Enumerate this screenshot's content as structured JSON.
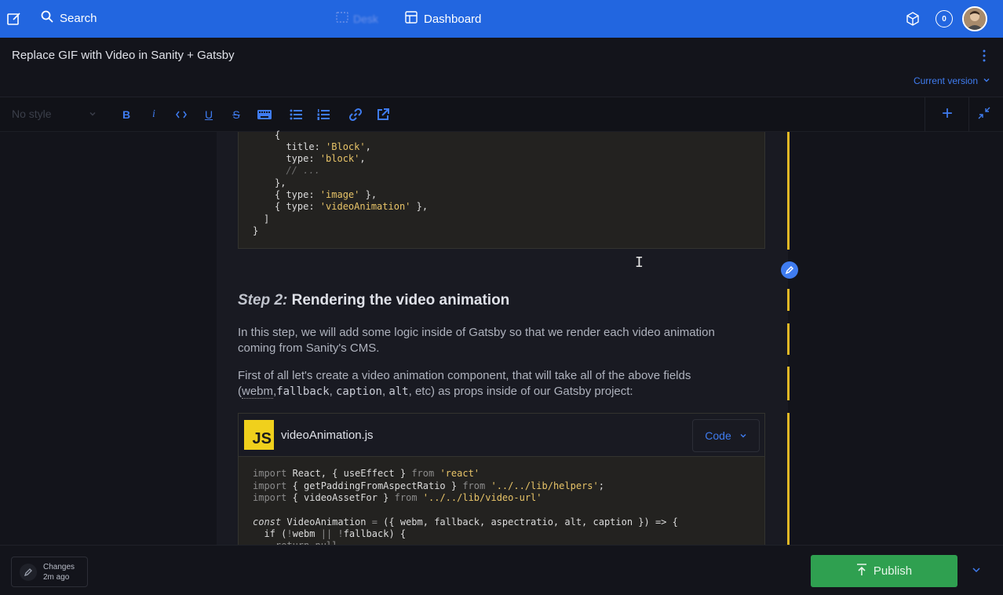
{
  "topbar": {
    "search_label": "Search",
    "desk_label": "Desk",
    "dashboard_label": "Dashboard",
    "notification_count": "0",
    "colors": {
      "background": "#2266e0"
    }
  },
  "document": {
    "title": "Replace GIF with Video in Sanity + Gatsby",
    "version_label": "Current version"
  },
  "toolbar": {
    "style_placeholder": "No style",
    "buttons": [
      "bold",
      "italic",
      "code",
      "underline",
      "strikethrough",
      "keyboard",
      "bullet-list",
      "numbered-list",
      "link",
      "external-link"
    ]
  },
  "editor": {
    "code_block_1_lines": [
      "{",
      "  title: 'Block',",
      "  type: 'block',",
      "  // ...",
      "},",
      "{ type: 'image' },",
      "{ type: 'videoAnimation' },",
      "]",
      "}"
    ],
    "heading_prefix": "Step 2:",
    "heading_text": " Rendering the video animation",
    "paragraph_1": "In this step, we will add some logic inside of Gatsby so that we render each video animation coming from Sanity's CMS.",
    "paragraph_2_parts": [
      "First of all let's create a video animation component, that will take all of the above fields (",
      "webm",
      ",",
      "fallback",
      ", ",
      "caption",
      ", ",
      "alt",
      ", etc) as props inside of our Gatsby project:"
    ],
    "code_block_2": {
      "language_badge": "JS",
      "file_name": "videoAnimation.js",
      "language_label": "Code",
      "lines": [
        "import React, { useEffect } from 'react'",
        "import { getPaddingFromAspectRatio } from '../../lib/helpers';",
        "import { videoAssetFor } from '../../lib/video-url'",
        "",
        "const VideoAnimation = ({ webm, fallback, aspectratio, alt, caption }) => {",
        "  if (!webm || !fallback) {",
        "    return null"
      ]
    },
    "colors": {
      "change_indicator": "#e1b826",
      "accent": "#3f7cf0"
    }
  },
  "footer": {
    "changes_label": "Changes",
    "changes_time": "2m ago",
    "publish_label": "Publish",
    "colors": {
      "publish": "#2fa050"
    }
  }
}
